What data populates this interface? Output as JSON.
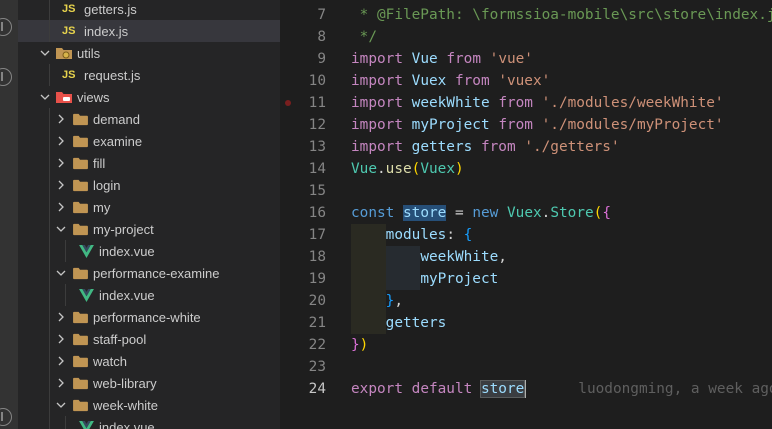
{
  "explorer": {
    "items": [
      {
        "type": "js",
        "label": "getters.js",
        "depth": 2,
        "selected": false
      },
      {
        "type": "js",
        "label": "index.js",
        "depth": 2,
        "selected": true
      },
      {
        "type": "folder-special",
        "label": "utils",
        "depth": 1,
        "open": true,
        "icon": "utils-folder-icon"
      },
      {
        "type": "js",
        "label": "request.js",
        "depth": 2
      },
      {
        "type": "folder-special",
        "label": "views",
        "depth": 1,
        "open": true,
        "icon": "views-folder-icon"
      },
      {
        "type": "folder",
        "label": "demand",
        "depth": 2,
        "open": false
      },
      {
        "type": "folder",
        "label": "examine",
        "depth": 2,
        "open": false
      },
      {
        "type": "folder",
        "label": "fill",
        "depth": 2,
        "open": false
      },
      {
        "type": "folder",
        "label": "login",
        "depth": 2,
        "open": false
      },
      {
        "type": "folder",
        "label": "my",
        "depth": 2,
        "open": false
      },
      {
        "type": "folder",
        "label": "my-project",
        "depth": 2,
        "open": true
      },
      {
        "type": "vue",
        "label": "index.vue",
        "depth": 3
      },
      {
        "type": "folder",
        "label": "performance-examine",
        "depth": 2,
        "open": true
      },
      {
        "type": "vue",
        "label": "index.vue",
        "depth": 3
      },
      {
        "type": "folder",
        "label": "performance-white",
        "depth": 2,
        "open": false
      },
      {
        "type": "folder",
        "label": "staff-pool",
        "depth": 2,
        "open": false
      },
      {
        "type": "folder",
        "label": "watch",
        "depth": 2,
        "open": false
      },
      {
        "type": "folder",
        "label": "web-library",
        "depth": 2,
        "open": false
      },
      {
        "type": "folder",
        "label": "week-white",
        "depth": 2,
        "open": true
      },
      {
        "type": "vue",
        "label": "index.vue",
        "depth": 3
      }
    ]
  },
  "editor": {
    "active_line": 24,
    "breakpoint_line": 11,
    "blame_text": "luodongming, a week ago",
    "lines": [
      {
        "n": "7",
        "tokens": [
          [
            "c-comment",
            " * @FilePath: \\formssioa-mobile\\src\\store\\index.js"
          ]
        ]
      },
      {
        "n": "8",
        "tokens": [
          [
            "c-comment",
            " */"
          ]
        ]
      },
      {
        "n": "9",
        "tokens": [
          [
            "c-ctrl",
            "import"
          ],
          [
            "c-plain",
            " "
          ],
          [
            "c-var",
            "Vue"
          ],
          [
            "c-plain",
            " "
          ],
          [
            "c-ctrl",
            "from"
          ],
          [
            "c-plain",
            " "
          ],
          [
            "c-str",
            "'vue'"
          ]
        ]
      },
      {
        "n": "10",
        "tokens": [
          [
            "c-ctrl",
            "import"
          ],
          [
            "c-plain",
            " "
          ],
          [
            "c-var",
            "Vuex"
          ],
          [
            "c-plain",
            " "
          ],
          [
            "c-ctrl",
            "from"
          ],
          [
            "c-plain",
            " "
          ],
          [
            "c-str",
            "'vuex'"
          ]
        ]
      },
      {
        "n": "11",
        "tokens": [
          [
            "c-ctrl",
            "import"
          ],
          [
            "c-plain",
            " "
          ],
          [
            "c-var",
            "weekWhite"
          ],
          [
            "c-plain",
            " "
          ],
          [
            "c-ctrl",
            "from"
          ],
          [
            "c-plain",
            " "
          ],
          [
            "c-str",
            "'./modules/weekWhite'"
          ]
        ]
      },
      {
        "n": "12",
        "tokens": [
          [
            "c-ctrl",
            "import"
          ],
          [
            "c-plain",
            " "
          ],
          [
            "c-var",
            "myProject"
          ],
          [
            "c-plain",
            " "
          ],
          [
            "c-ctrl",
            "from"
          ],
          [
            "c-plain",
            " "
          ],
          [
            "c-str",
            "'./modules/myProject'"
          ]
        ]
      },
      {
        "n": "13",
        "tokens": [
          [
            "c-ctrl",
            "import"
          ],
          [
            "c-plain",
            " "
          ],
          [
            "c-var",
            "getters"
          ],
          [
            "c-plain",
            " "
          ],
          [
            "c-ctrl",
            "from"
          ],
          [
            "c-plain",
            " "
          ],
          [
            "c-str",
            "'./getters'"
          ]
        ]
      },
      {
        "n": "14",
        "tokens": [
          [
            "c-cls",
            "Vue"
          ],
          [
            "c-plain",
            "."
          ],
          [
            "c-fn",
            "use"
          ],
          [
            "c-brk1",
            "("
          ],
          [
            "c-cls",
            "Vuex"
          ],
          [
            "c-brk1",
            ")"
          ]
        ]
      },
      {
        "n": "15",
        "tokens": []
      },
      {
        "n": "16",
        "tokens": [
          [
            "c-kw",
            "const"
          ],
          [
            "c-plain",
            " "
          ],
          [
            "c-var hl-word",
            "store"
          ],
          [
            "c-plain",
            " = "
          ],
          [
            "c-kw",
            "new"
          ],
          [
            "c-plain",
            " "
          ],
          [
            "c-cls",
            "Vuex"
          ],
          [
            "c-plain",
            "."
          ],
          [
            "c-cls",
            "Store"
          ],
          [
            "c-brk1",
            "("
          ],
          [
            "c-brk2",
            "{"
          ]
        ]
      },
      {
        "n": "17",
        "tokens": [
          [
            "c-plain",
            "    "
          ],
          [
            "c-var",
            "modules"
          ],
          [
            "c-plain",
            ": "
          ],
          [
            "c-brk3",
            "{"
          ]
        ]
      },
      {
        "n": "18",
        "tokens": [
          [
            "c-plain",
            "        "
          ],
          [
            "c-var",
            "weekWhite"
          ],
          [
            "c-plain",
            ","
          ]
        ]
      },
      {
        "n": "19",
        "tokens": [
          [
            "c-plain",
            "        "
          ],
          [
            "c-var",
            "myProject"
          ]
        ]
      },
      {
        "n": "20",
        "tokens": [
          [
            "c-plain",
            "    "
          ],
          [
            "c-brk3",
            "}"
          ],
          [
            "c-plain",
            ","
          ]
        ]
      },
      {
        "n": "21",
        "tokens": [
          [
            "c-plain",
            "    "
          ],
          [
            "c-var",
            "getters"
          ]
        ]
      },
      {
        "n": "22",
        "tokens": [
          [
            "c-brk2",
            "}"
          ],
          [
            "c-brk1",
            ")"
          ]
        ]
      },
      {
        "n": "23",
        "tokens": []
      },
      {
        "n": "24",
        "tokens": [
          [
            "c-ctrl",
            "export"
          ],
          [
            "c-plain",
            " "
          ],
          [
            "c-ctrl",
            "default"
          ],
          [
            "c-plain",
            " "
          ],
          [
            "c-var hl-word2",
            "store"
          ]
        ]
      }
    ]
  }
}
